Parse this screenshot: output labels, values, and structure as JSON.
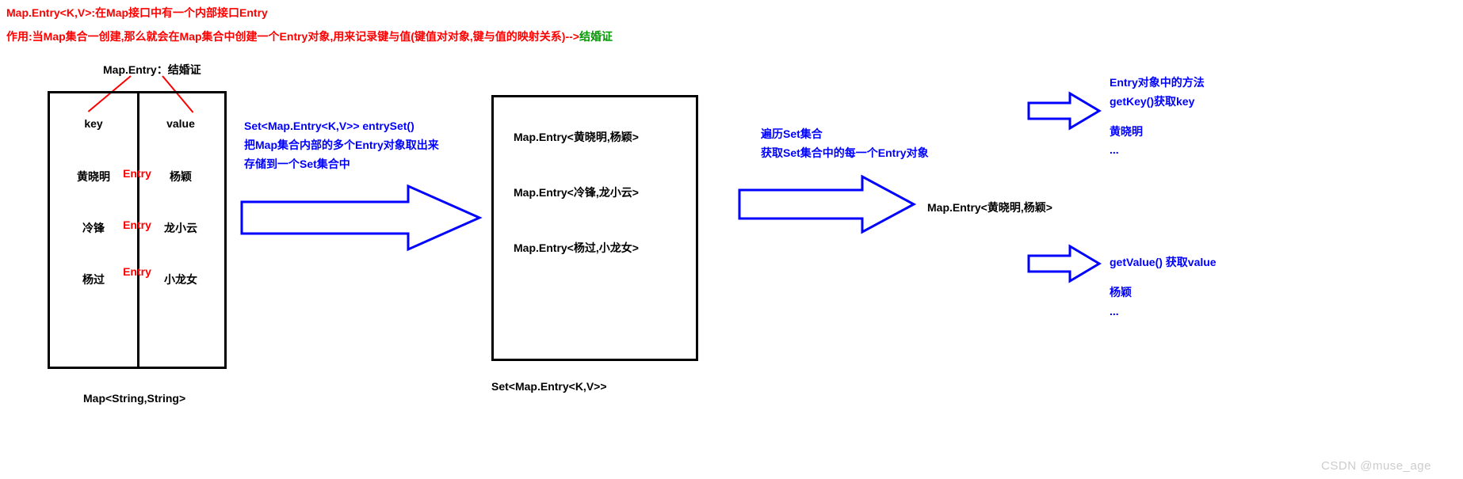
{
  "header": {
    "line1": "Map.Entry<K,V>:在Map接口中有一个内部接口Entry",
    "line2_pre": "作用:当Map集合一创建,那么就会在Map集合中创建一个Entry对象,用来记录键与值(键值对对象,键与值的映射关系)-->",
    "line2_green": "结婚证"
  },
  "map_title": {
    "left": "Map.Entry",
    "colon": "：",
    "right": "结婚证"
  },
  "map_table": {
    "headers": {
      "key": "key",
      "value": "value"
    },
    "entry_label": "Entry",
    "rows": [
      {
        "key": "黄晓明",
        "value": "杨颖"
      },
      {
        "key": "冷锋",
        "value": "龙小云"
      },
      {
        "key": "杨过",
        "value": "小龙女"
      }
    ],
    "caption": "Map<String,String>"
  },
  "arrow1_text": {
    "l1": "Set<Map.Entry<K,V>> entrySet()",
    "l2": " 把Map集合内部的多个Entry对象取出来",
    "l3": "存储到一个Set集合中"
  },
  "set_box": {
    "rows": [
      "Map.Entry<黄晓明,杨颖>",
      "Map.Entry<冷锋,龙小云>",
      "Map.Entry<杨过,小龙女>"
    ],
    "caption": "Set<Map.Entry<K,V>>"
  },
  "arrow2_text": {
    "l1": "遍历Set集合",
    "l2": "获取Set集合中的每一个Entry对象"
  },
  "single_entry": "Map.Entry<黄晓明,杨颖>",
  "methods": {
    "title": "Entry对象中的方法",
    "getkey": "getKey()获取key",
    "key_val": "黄晓明",
    "ell1": "...",
    "getvalue": "getValue()  获取value",
    "value_val": "杨颖",
    "ell2": "..."
  },
  "watermark": "CSDN @muse_age",
  "colors": {
    "blue": "#0000ff",
    "red": "#ff0000"
  }
}
